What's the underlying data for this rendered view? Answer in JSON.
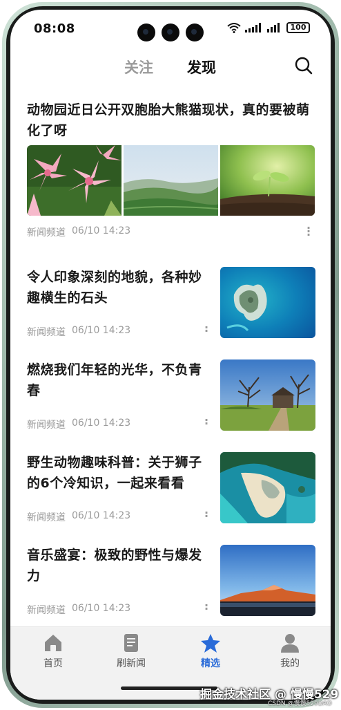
{
  "status_bar": {
    "time": "08:08",
    "battery": "100"
  },
  "header": {
    "tabs": [
      {
        "label": "关注",
        "active": false
      },
      {
        "label": "发现",
        "active": true
      }
    ]
  },
  "feed": [
    {
      "title": "动物园近日公开双胞胎大熊猫现状，真的要被萌化了呀",
      "source": "新闻频道",
      "date": "06/10 14:23",
      "images": [
        "pink-lily-flowers",
        "green-tea-hills-misty",
        "seedling-in-soil"
      ]
    },
    {
      "title": "令人印象深刻的地貌，各种妙趣横生的石头",
      "source": "新闻频道",
      "date": "06/10 14:23",
      "image": "island-in-blue-sea-aerial"
    },
    {
      "title": "燃烧我们年轻的光华，不负青春",
      "source": "新闻频道",
      "date": "06/10 14:23",
      "image": "bare-trees-and-house-meadow"
    },
    {
      "title": "野生动物趣味科普：关于狮子的6个冷知识，一起来看看",
      "source": "新闻频道",
      "date": "06/10 14:23",
      "image": "tropical-beach-aerial"
    },
    {
      "title": "音乐盛宴：极致的野性与爆发力",
      "source": "新闻频道",
      "date": "06/10 14:23",
      "image": "sunset-mountain-lake"
    }
  ],
  "bottom_nav": [
    {
      "label": "首页",
      "icon": "home-icon",
      "active": false
    },
    {
      "label": "刷新闻",
      "icon": "news-icon",
      "active": false
    },
    {
      "label": "精选",
      "icon": "star-icon",
      "active": true
    },
    {
      "label": "我的",
      "icon": "person-icon",
      "active": false
    }
  ],
  "colors": {
    "accent": "#2a6bd8",
    "meta_text": "#9a9a9a",
    "inactive_tab": "#9a9a9a"
  },
  "watermark": {
    "main": "掘金技术社区 @ 慢慢529",
    "small": "CSDN @慢慢529DAO"
  }
}
